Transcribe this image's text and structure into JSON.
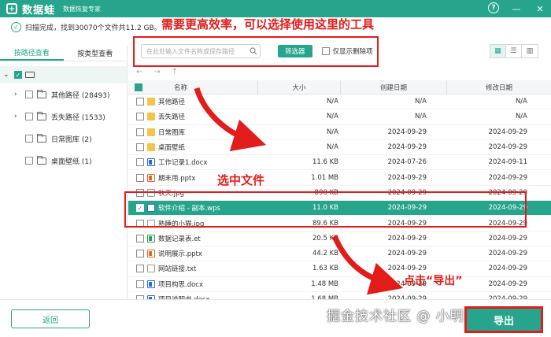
{
  "app": {
    "name": "数据蛙",
    "subtitle": "数据恢复专家",
    "logo_glyph": "+",
    "help_glyph": "?",
    "minimize_glyph": "—",
    "close_glyph": "✕"
  },
  "status": {
    "text": "扫描完成，找到30070个文件共11.2 GB。"
  },
  "sidebar": {
    "tabs": [
      {
        "label": "按路径查看",
        "active": true
      },
      {
        "label": "按类型查看",
        "active": false
      }
    ],
    "tree": [
      {
        "label": "其他路径 (28493)",
        "expandable": true
      },
      {
        "label": "丢失路径 (1533)",
        "expandable": true
      },
      {
        "label": "日常图库 (2)",
        "expandable": false
      },
      {
        "label": "桌面壁纸 (1)",
        "expandable": false
      }
    ]
  },
  "toolbar": {
    "search_placeholder": "在此处输入文件名称或保存路径",
    "filter_label": "筛选器",
    "only_deleted_label": "仅显示删除项"
  },
  "table": {
    "headers": {
      "name": "名称",
      "size": "大小",
      "created": "创建日期",
      "modified": "修改日期"
    },
    "rows": [
      {
        "name": "其他路径",
        "type": "folder",
        "size": "N/A",
        "created": "N/A",
        "modified": "N/A",
        "selected": false
      },
      {
        "name": "丢失路径",
        "type": "folder",
        "size": "N/A",
        "created": "N/A",
        "modified": "N/A",
        "selected": false
      },
      {
        "name": "日常图库",
        "type": "folder",
        "size": "N/A",
        "created": "2024-09-29",
        "modified": "2024-09-29",
        "selected": false
      },
      {
        "name": "桌面壁纸",
        "type": "folder",
        "size": "N/A",
        "created": "2024-09-29",
        "modified": "2024-09-29",
        "selected": false
      },
      {
        "name": "工作记录1.docx",
        "type": "docx",
        "size": "11.6 KB",
        "created": "2024-07-26",
        "modified": "2024-09-11",
        "selected": false
      },
      {
        "name": "期末用.pptx",
        "type": "pptx",
        "size": "1.01 MB",
        "created": "2024-09-29",
        "modified": "2024-09-29",
        "selected": false
      },
      {
        "name": "秋天.jpg",
        "type": "jpg",
        "size": "890 KB",
        "created": "2024-09-29",
        "modified": "2024-09-29",
        "selected": false
      },
      {
        "name": "软件介绍 - 副本.wps",
        "type": "wps",
        "size": "11.0 KB",
        "created": "2024-09-29",
        "modified": "2024-09-29",
        "selected": true
      },
      {
        "name": "熟睡的小猫.jpg",
        "type": "jpg",
        "size": "89.6 KB",
        "created": "2024-09-29",
        "modified": "2024-09-29",
        "selected": false
      },
      {
        "name": "数据记录表.et",
        "type": "et",
        "size": "20.5 KB",
        "created": "2024-09-29",
        "modified": "2024-09-29",
        "selected": false
      },
      {
        "name": "说明展示.pptx",
        "type": "pptx",
        "size": "44.2 KB",
        "created": "2024-09-29",
        "modified": "2024-09-29",
        "selected": false
      },
      {
        "name": "网站链接.txt",
        "type": "txt",
        "size": "1.63 KB",
        "created": "2024-09-29",
        "modified": "2024-09-29",
        "selected": false
      },
      {
        "name": "项目构思.docx",
        "type": "docx",
        "size": "1.48 MB",
        "created": "2024-09-29",
        "modified": "2024-09-29",
        "selected": false
      },
      {
        "name": "项目说明书.docx",
        "type": "docx",
        "size": "1.68 MB",
        "created": "2024-09-29",
        "modified": "2024-09-29",
        "selected": false
      }
    ]
  },
  "bottom": {
    "back_label": "返回",
    "export_label": "导出",
    "watermark": "掘金技术社区 @ 小明助手"
  },
  "annotations": {
    "top_tip": "需要更高效率，可以选择使用这里的工具",
    "select_tip": "选中文件",
    "export_tip": "点击“导出”"
  },
  "colors": {
    "accent": "#27a58c",
    "annotation": "#e21b1b"
  }
}
